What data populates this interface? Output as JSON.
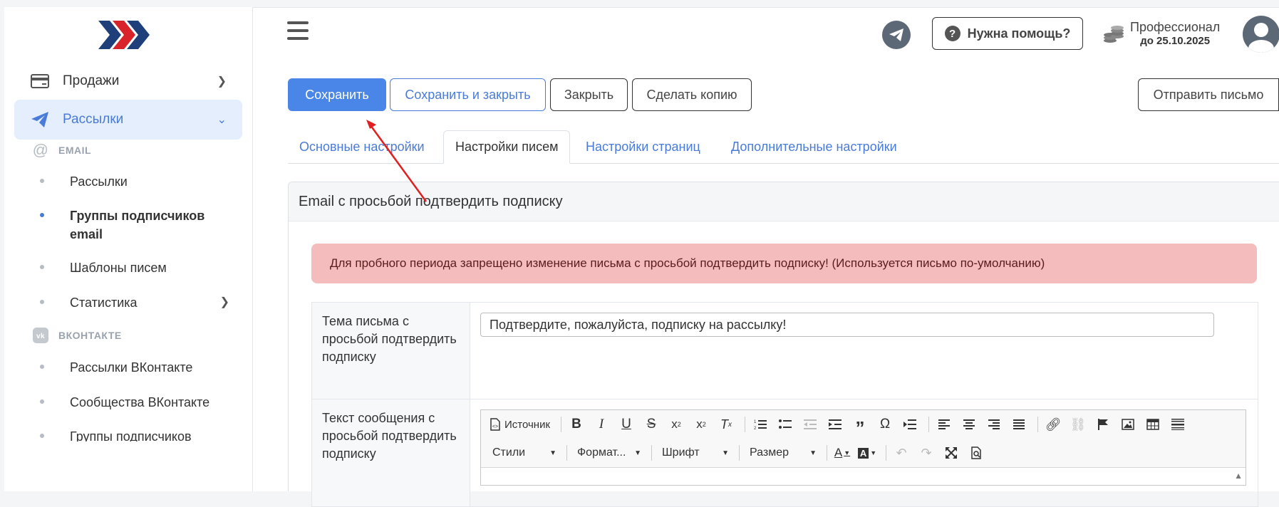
{
  "sidebar": {
    "items": [
      {
        "label": "Продажи",
        "icon": "card-icon"
      },
      {
        "label": "Рассылки",
        "icon": "paper-plane-icon"
      }
    ],
    "section_email": "EMAIL",
    "email_items": [
      {
        "label": "Рассылки"
      },
      {
        "label": "Группы подписчиков email"
      },
      {
        "label": "Шаблоны писем"
      },
      {
        "label": "Статистика"
      }
    ],
    "section_vk": "ВКОНТАКТЕ",
    "vk_items": [
      {
        "label": "Рассылки ВКонтакте"
      },
      {
        "label": "Сообщества ВКонтакте"
      },
      {
        "label": "Группы подписчиков"
      }
    ]
  },
  "topbar": {
    "help_label": "Нужна помощь?",
    "plan_name": "Профессионал",
    "plan_until": "до 25.10.2025"
  },
  "toolbar": {
    "save": "Сохранить",
    "save_close": "Сохранить и закрыть",
    "close": "Закрыть",
    "copy": "Сделать копию",
    "send": "Отправить письмо"
  },
  "tabs": [
    {
      "label": "Основные настройки"
    },
    {
      "label": "Настройки писем"
    },
    {
      "label": "Настройки страниц"
    },
    {
      "label": "Дополнительные настройки"
    }
  ],
  "card": {
    "title": "Email с просьбой подтвердить подписку",
    "alert": "Для пробного периода запрещено изменение письма с просьбой подтвердить подписку! (Используется письмо по-умолчанию)",
    "subject_label": "Тема письма с просьбой подтвердить подписку",
    "subject_value": "Подтвердите, пожалуйста, подписку на рассылку!",
    "body_label": "Текст сообщения с просьбой подтвердить подписку"
  },
  "editor": {
    "source": "Источник",
    "styles": "Стили",
    "format": "Формат...",
    "font": "Шрифт",
    "size": "Размер"
  },
  "colors": {
    "accent": "#4a86e8",
    "link": "#4a7bd8",
    "alert_bg": "#f4bcbc",
    "annotation_arrow": "#e02020"
  }
}
